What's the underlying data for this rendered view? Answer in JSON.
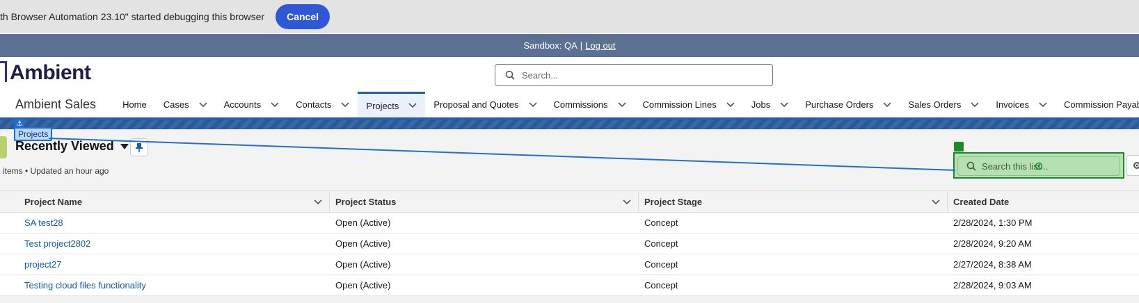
{
  "debug_bar": {
    "text": "th Browser Automation 23.10\" started debugging this browser",
    "cancel_label": "Cancel"
  },
  "sandbox": {
    "text": "Sandbox: QA",
    "separator": "|",
    "logout_label": "Log out"
  },
  "header": {
    "logo": "Ambient",
    "search_placeholder": "Search..."
  },
  "nav": {
    "app_name": "Ambient Sales",
    "items": [
      {
        "label": "Home",
        "has_menu": false,
        "active": false
      },
      {
        "label": "Cases",
        "has_menu": true,
        "active": false
      },
      {
        "label": "Accounts",
        "has_menu": true,
        "active": false
      },
      {
        "label": "Contacts",
        "has_menu": true,
        "active": false
      },
      {
        "label": "Projects",
        "has_menu": true,
        "active": true
      },
      {
        "label": "Proposal and Quotes",
        "has_menu": true,
        "active": false
      },
      {
        "label": "Commissions",
        "has_menu": true,
        "active": false
      },
      {
        "label": "Commission Lines",
        "has_menu": true,
        "active": false
      },
      {
        "label": "Jobs",
        "has_menu": true,
        "active": false
      },
      {
        "label": "Purchase Orders",
        "has_menu": true,
        "active": false
      },
      {
        "label": "Sales Orders",
        "has_menu": true,
        "active": false
      },
      {
        "label": "Invoices",
        "has_menu": true,
        "active": false
      },
      {
        "label": "Commission Payables",
        "has_menu": true,
        "active": false
      }
    ]
  },
  "list_view": {
    "object_label": "Projects",
    "title": "Recently Viewed",
    "meta": "items • Updated an hour ago",
    "search_placeholder": "Search this list..."
  },
  "table": {
    "columns": [
      "Project Name",
      "Project Status",
      "Project Stage",
      "Created Date"
    ],
    "rows": [
      [
        "SA test28",
        "Open (Active)",
        "Concept",
        "2/28/2024, 1:30 PM"
      ],
      [
        "Test project2802",
        "Open (Active)",
        "Concept",
        "2/28/2024, 9:20 AM"
      ],
      [
        "project27",
        "Open (Active)",
        "Concept",
        "2/27/2024, 8:38 AM"
      ],
      [
        "Testing cloud files functionality",
        "Open (Active)",
        "Concept",
        "2/28/2024, 9:03 AM"
      ]
    ]
  },
  "colors": {
    "brand_blue": "#1b5fb0",
    "cancel_blue": "#2f57d6",
    "sandbox_bg": "#5c7092",
    "link": "#0b5cab",
    "highlight_green": "#1a8a2a"
  }
}
